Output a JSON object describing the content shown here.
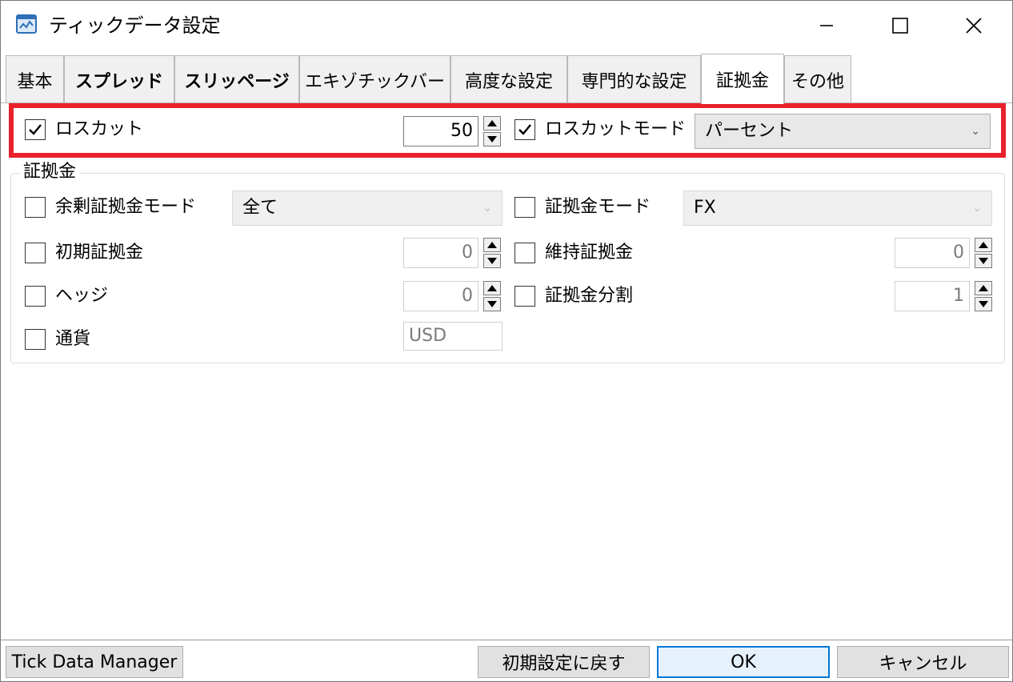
{
  "window": {
    "title": "ティックデータ設定",
    "icons": {
      "app": "chart-window-icon",
      "minimize": "minimize-icon",
      "maximize": "maximize-icon",
      "close": "close-icon"
    }
  },
  "tabs": [
    {
      "label": "基本",
      "active": false
    },
    {
      "label": "スプレッド",
      "active": false
    },
    {
      "label": "スリッページ",
      "active": false
    },
    {
      "label": "エキゾチックバー",
      "active": false
    },
    {
      "label": "高度な設定",
      "active": false
    },
    {
      "label": "専門的な設定",
      "active": false
    },
    {
      "label": "証拠金",
      "active": true
    },
    {
      "label": "その他",
      "active": false
    }
  ],
  "stop_out": {
    "checkbox_label": "ロスカット",
    "checked": true,
    "value": "50",
    "mode_label": "ロスカットモード",
    "mode_checked": true,
    "mode_value": "パーセント"
  },
  "margin_group": {
    "title": "証拠金",
    "free_margin_mode": {
      "label": "余剰証拠金モード",
      "checked": false,
      "value": "全て"
    },
    "margin_mode": {
      "label": "証拠金モード",
      "checked": false,
      "value": "FX"
    },
    "initial_margin": {
      "label": "初期証拠金",
      "checked": false,
      "value": "0"
    },
    "maintenance_margin": {
      "label": "維持証拠金",
      "checked": false,
      "value": "0"
    },
    "hedge": {
      "label": "ヘッジ",
      "checked": false,
      "value": "0"
    },
    "margin_divider": {
      "label": "証拠金分割",
      "checked": false,
      "value": "1"
    },
    "currency": {
      "label": "通貨",
      "checked": false,
      "value": "USD"
    }
  },
  "footer": {
    "manager_button": "Tick Data Manager",
    "reset_button": "初期設定に戻す",
    "ok_button": "OK",
    "cancel_button": "キャンセル"
  },
  "colors": {
    "highlight": "#e8212b",
    "default_button_border": "#0078d7"
  }
}
